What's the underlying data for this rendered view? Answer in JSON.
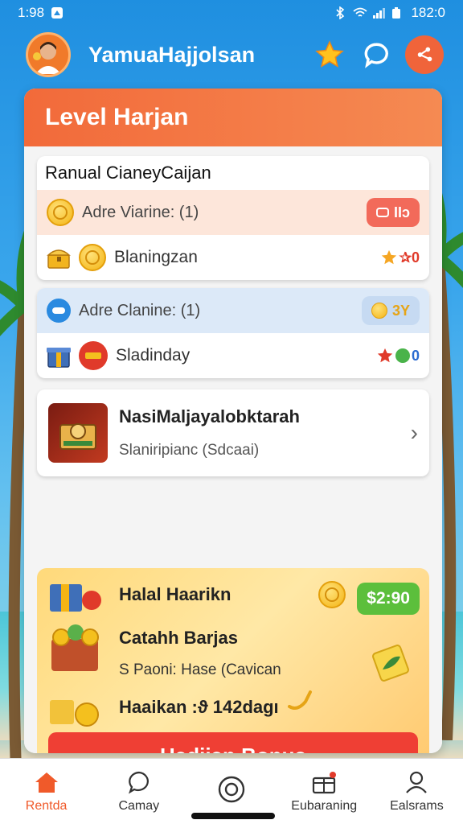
{
  "status_bar": {
    "time": "1:98",
    "right_text": "182:0"
  },
  "header": {
    "username": "YamuaHajjolsan"
  },
  "card": {
    "title": "Level Harjan",
    "section1": {
      "title": "Ranual CianeyCaijan",
      "rows": [
        {
          "label": "Adre Viarine: (1)",
          "badge": "IIɔ"
        },
        {
          "label": "Blaningzan",
          "badge": "✰0"
        }
      ]
    },
    "section2": {
      "rows": [
        {
          "label": "Adre Clanine: (1)",
          "badge": "3Y"
        },
        {
          "label": "Sladinday",
          "badge": "0"
        }
      ]
    },
    "promo": {
      "title": "NasiMaljayalobktarah",
      "subtitle": "Slaniripianc (Sdcaai)"
    },
    "bonus": {
      "line1": "Halal Haarikn",
      "price": "$2:90",
      "line2": "Catahh Barjas",
      "line3": "S Paoni: Hase (Cavican",
      "line4": "Haaikan :ϑ 142dagı",
      "button": "Hadiian Bonus"
    }
  },
  "nav": {
    "items": [
      {
        "label": "Rentda"
      },
      {
        "label": "Camay"
      },
      {
        "label": ""
      },
      {
        "label": "Eubaraning"
      },
      {
        "label": "Ealsrams"
      }
    ]
  },
  "colors": {
    "accent": "#f26a3a",
    "button": "#ef3f34",
    "price": "#5cbf3c"
  }
}
